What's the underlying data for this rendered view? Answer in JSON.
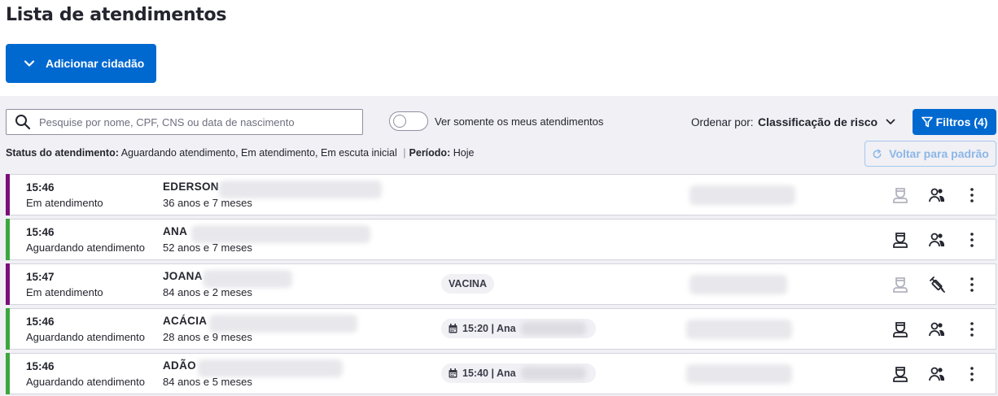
{
  "page_title": "Lista de atendimentos",
  "add_button": {
    "label": "Adicionar cidadão"
  },
  "search": {
    "placeholder": "Pesquise por nome, CPF, CNS ou data de nascimento",
    "value": ""
  },
  "toggle": {
    "label": "Ver somente os meus atendimentos",
    "on": false
  },
  "order": {
    "label": "Ordenar por:",
    "value": "Classificação de risco"
  },
  "filter_button": {
    "label": "Filtros (4)"
  },
  "status_line": {
    "status_label": "Status do atendimento:",
    "status_value": "Aguardando atendimento, Em atendimento, Em escuta inicial",
    "separator": "|",
    "period_label": "Período:",
    "period_value": "Hoje"
  },
  "reset_button": {
    "label": "Voltar para padrão"
  },
  "colors": {
    "primary": "#0069d0",
    "in_progress": "#7b0e7b",
    "waiting": "#3da73d"
  },
  "rows": [
    {
      "time": "15:46",
      "status": "Em atendimento",
      "name": "EDERSON",
      "age": "36 anos e 7 meses",
      "tag": "",
      "stripe": "in_progress",
      "action1": "doctor-icon",
      "action1_disabled": true,
      "action2": "people-icon"
    },
    {
      "time": "15:46",
      "status": "Aguardando atendimento",
      "name": "ANA",
      "age": "52 anos e 7 meses",
      "tag": "",
      "stripe": "waiting",
      "action1": "doctor-icon",
      "action1_disabled": false,
      "action2": "people-icon"
    },
    {
      "time": "15:47",
      "status": "Em atendimento",
      "name": "JOANA",
      "age": "84 anos e 2 meses",
      "tag": "VACINA",
      "stripe": "in_progress",
      "action1": "doctor-icon",
      "action1_disabled": true,
      "action2": "syringe-icon"
    },
    {
      "time": "15:46",
      "status": "Aguardando atendimento",
      "name": "ACÁCIA",
      "age": "28 anos e 9 meses",
      "tag": "15:20 | Ana",
      "stripe": "waiting",
      "action1": "doctor-icon",
      "action1_disabled": false,
      "action2": "people-icon"
    },
    {
      "time": "15:46",
      "status": "Aguardando atendimento",
      "name": "ADÃO",
      "age": "84 anos e 5 meses",
      "tag": "15:40 | Ana",
      "stripe": "waiting",
      "action1": "doctor-icon",
      "action1_disabled": false,
      "action2": "people-icon"
    }
  ]
}
